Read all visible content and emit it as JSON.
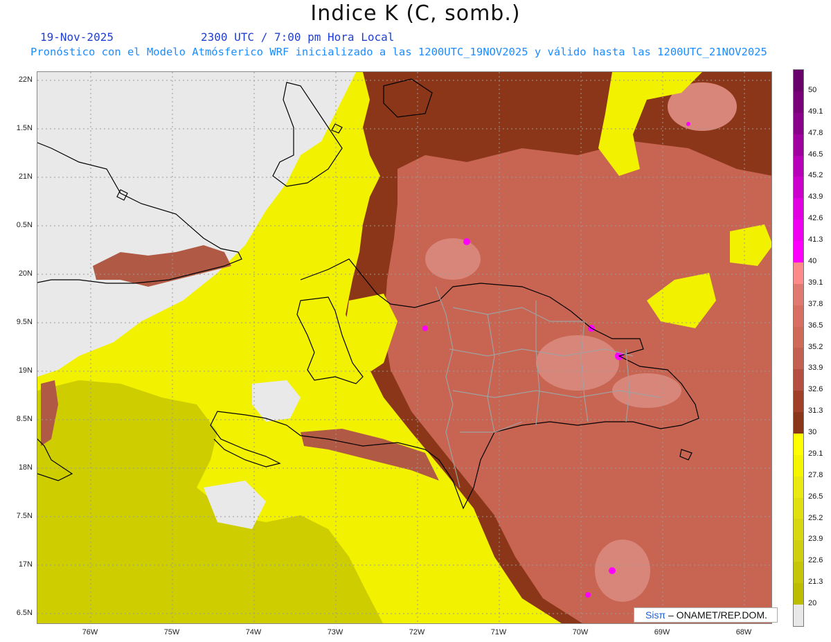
{
  "header": {
    "title": "Indice K (C, somb.)",
    "date": "19-Nov-2025",
    "time": "2300 UTC / 7:00 pm Hora Local",
    "forecast": "Pronóstico con el Modelo Atmósferico WRF inicializado a las 1200UTC_19NOV2025 y válido hasta las  1200UTC_21NOV2025"
  },
  "map": {
    "y_ticks": [
      "22N",
      "1.5N",
      "21N",
      "0.5N",
      "20N",
      "9.5N",
      "19N",
      "8.5N",
      "18N",
      "7.5N",
      "17N",
      "6.5N"
    ],
    "x_ticks": [
      "76W",
      "75W",
      "74W",
      "73W",
      "72W",
      "71W",
      "70W",
      "69W",
      "68W"
    ],
    "colors": {
      "land_ocean_bg": "#e9e9e9",
      "yellow": "#f2f200",
      "dark_yellow": "#c8c800",
      "brown": "#8b3519",
      "salmon": "#c76552",
      "pink": "#d9867a",
      "magenta": "#ff00ff",
      "coast": "#000000",
      "province": "#a0a0a0"
    }
  },
  "colorbar": {
    "labels": [
      "50",
      "49.1",
      "47.8",
      "46.5",
      "45.2",
      "43.9",
      "42.6",
      "41.3",
      "40",
      "39.1",
      "37.8",
      "36.5",
      "35.2",
      "33.9",
      "32.6",
      "31.3",
      "30",
      "29.1",
      "27.8",
      "26.5",
      "25.2",
      "23.9",
      "22.6",
      "21.3",
      "20"
    ],
    "colors": [
      "#6a006a",
      "#7a007a",
      "#8a008a",
      "#a000a0",
      "#b800b8",
      "#cc00cc",
      "#e000e0",
      "#f000f0",
      "#ff00ff",
      "#ff8a8a",
      "#e07a70",
      "#d96f60",
      "#cf6a58",
      "#c46050",
      "#b55040",
      "#a04028",
      "#8b3519",
      "#ffff00",
      "#f5f500",
      "#eaea10",
      "#e0e010",
      "#d8d810",
      "#cfcf10",
      "#c6c608",
      "#bcbc00",
      "#e8e8e8"
    ]
  },
  "credit": {
    "sis": "Sisπ",
    "rest": "– ONAMET/REP.DOM."
  }
}
